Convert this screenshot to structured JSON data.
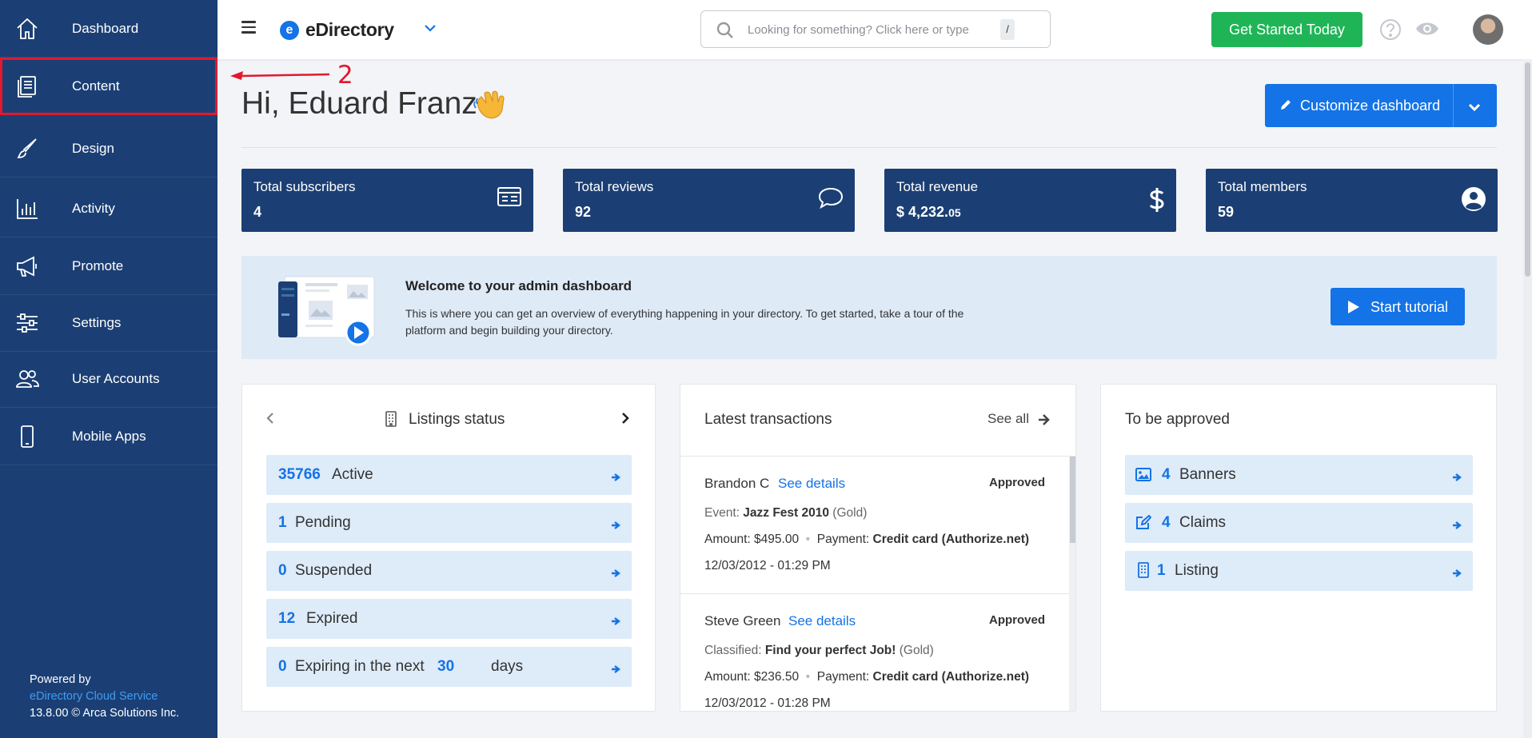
{
  "sidebar": {
    "items": [
      {
        "label": "Dashboard",
        "icon": "home-icon"
      },
      {
        "label": "Content",
        "icon": "content-icon"
      },
      {
        "label": "Design",
        "icon": "brush-icon"
      },
      {
        "label": "Activity",
        "icon": "bar-chart-icon"
      },
      {
        "label": "Promote",
        "icon": "megaphone-icon"
      },
      {
        "label": "Settings",
        "icon": "sliders-icon"
      },
      {
        "label": "User Accounts",
        "icon": "users-icon"
      },
      {
        "label": "Mobile Apps",
        "icon": "phone-icon"
      }
    ],
    "footer": {
      "powered_by": "Powered by",
      "service_link": "eDirectory Cloud Service",
      "version": "13.8.00 © Arca Solutions Inc."
    }
  },
  "header": {
    "brand": "eDirectory",
    "brand_logo_letter": "e",
    "search_placeholder": "Looking for something? Click here or type",
    "search_shortcut": "/",
    "cta_label": "Get Started Today"
  },
  "annotation": {
    "number": "2",
    "color": "#e3182d"
  },
  "main": {
    "greeting": "Hi, Eduard Franz",
    "customize_label": "Customize dashboard",
    "stats": [
      {
        "title": "Total subscribers",
        "value": "4",
        "icon": "newsletter-icon"
      },
      {
        "title": "Total reviews",
        "value": "92",
        "icon": "comment-icon"
      },
      {
        "title": "Total revenue",
        "value": "$ 4,232.",
        "cents": "05",
        "icon": "dollar-icon"
      },
      {
        "title": "Total members",
        "value": "59",
        "icon": "user-circle-icon"
      }
    ],
    "welcome": {
      "title": "Welcome to your admin dashboard",
      "description": "This is where you can get an overview of everything happening in your directory. To get started, take a tour of the platform and begin building your directory.",
      "button": "Start tutorial"
    },
    "listings_status": {
      "title": "Listings status",
      "rows": [
        {
          "num": "35766",
          "label": "Active"
        },
        {
          "num": "1",
          "label": "Pending"
        },
        {
          "num": "0",
          "label": "Suspended"
        },
        {
          "num": "12",
          "label": "Expired"
        },
        {
          "num": "0",
          "label": "Expiring in the next",
          "num2": "30",
          "label2": "days"
        }
      ]
    },
    "transactions": {
      "title": "Latest transactions",
      "see_all": "See all",
      "items": [
        {
          "name": "Brandon C",
          "see": "See details",
          "status": "Approved",
          "type": "Event:",
          "item": "Jazz Fest 2010",
          "level": "(Gold)",
          "amount": "Amount: $495.00",
          "payment_label": "Payment:",
          "payment": "Credit card (Authorize.net)",
          "date": "12/03/2012 - 01:29 PM"
        },
        {
          "name": "Steve Green",
          "see": "See details",
          "status": "Approved",
          "type": "Classified:",
          "item": "Find your perfect Job!",
          "level": "(Gold)",
          "amount": "Amount: $236.50",
          "payment_label": "Payment:",
          "payment": "Credit card (Authorize.net)",
          "date": "12/03/2012 - 01:28 PM"
        }
      ]
    },
    "to_be_approved": {
      "title": "To be approved",
      "rows": [
        {
          "num": "4",
          "label": "Banners",
          "icon": "image-icon"
        },
        {
          "num": "4",
          "label": "Claims",
          "icon": "edit-icon"
        },
        {
          "num": "1",
          "label": "Listing",
          "icon": "building-icon"
        }
      ]
    }
  },
  "colors": {
    "sidebar": "#1b3f74",
    "accent": "#1473e6",
    "cta": "#1fb557",
    "panel": "#deebf8"
  }
}
